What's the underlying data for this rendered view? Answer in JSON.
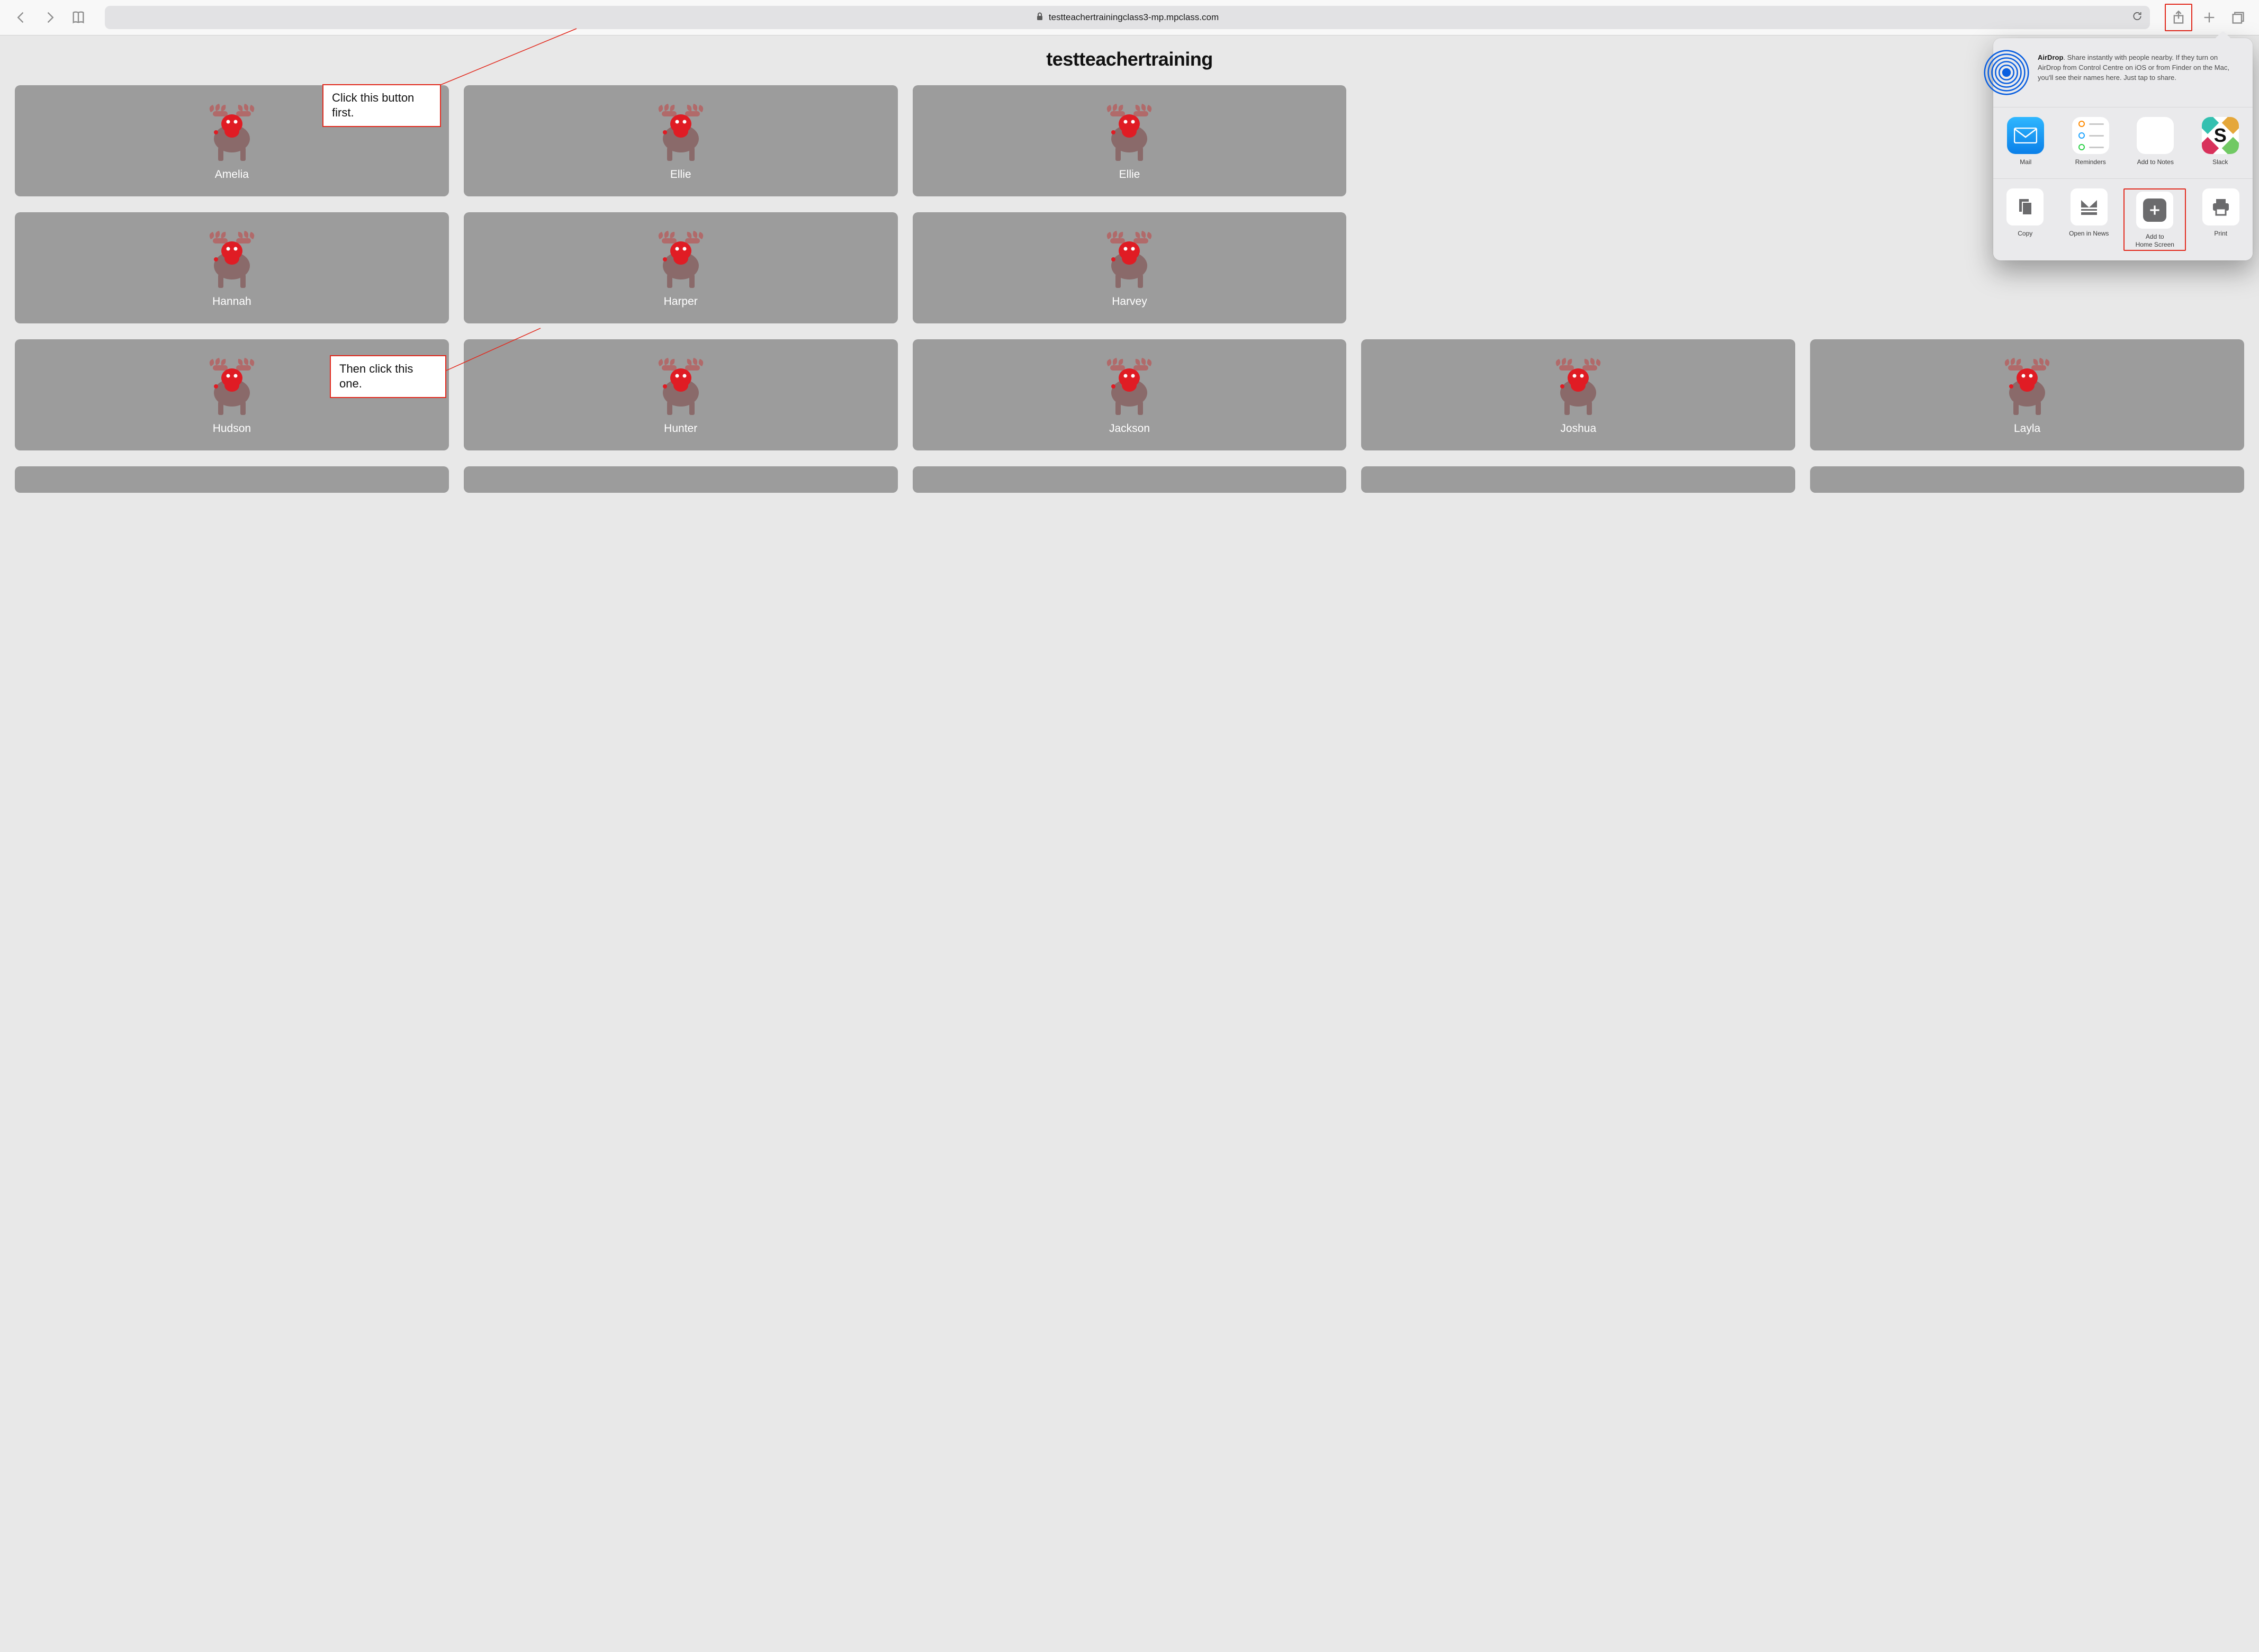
{
  "toolbar": {
    "url": "testteachertrainingclass3-mp.mpclass.com"
  },
  "page": {
    "title": "testteachertraining"
  },
  "students": [
    "Amelia",
    "Ellie",
    "Ellie",
    "",
    "",
    "Hannah",
    "Harper",
    "Harvey",
    "",
    "",
    "Hudson",
    "Hunter",
    "Jackson",
    "Joshua",
    "Layla"
  ],
  "share_sheet": {
    "airdrop_bold": "AirDrop",
    "airdrop_text": ". Share instantly with people nearby. If they turn on AirDrop from Control Centre on iOS or from Finder on the Mac, you'll see their names here. Just tap to share.",
    "apps": [
      {
        "id": "mail",
        "label": "Mail"
      },
      {
        "id": "reminders",
        "label": "Reminders"
      },
      {
        "id": "notes",
        "label": "Add to Notes"
      },
      {
        "id": "slack",
        "label": "Slack"
      }
    ],
    "actions": [
      {
        "id": "copy",
        "label": "Copy"
      },
      {
        "id": "open-in-news",
        "label": "Open in News"
      },
      {
        "id": "add-homescreen",
        "label": "Add to\nHome Screen"
      },
      {
        "id": "print",
        "label": "Print"
      }
    ]
  },
  "callouts": {
    "first": "Click this button first.",
    "second": "Then click this one."
  }
}
